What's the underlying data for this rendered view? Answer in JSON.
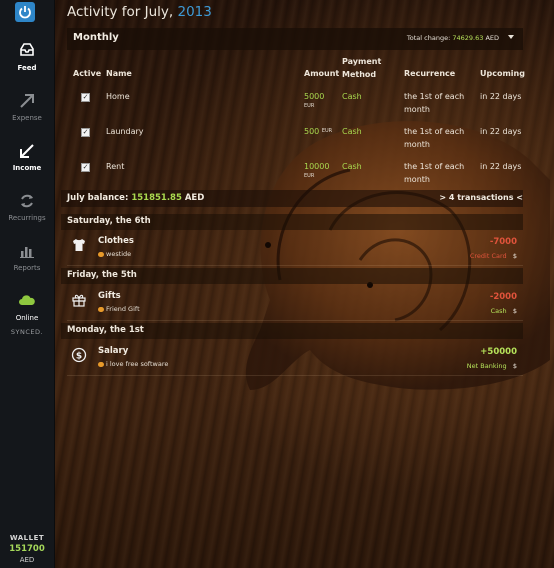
{
  "sidebar": {
    "app_icon": "power-icon",
    "items": [
      {
        "label": "Feed",
        "icon": "inbox-icon",
        "active": true
      },
      {
        "label": "Expense",
        "icon": "arrow-up-right-icon",
        "active": false
      },
      {
        "label": "Income",
        "icon": "arrow-down-left-icon",
        "active": true
      },
      {
        "label": "Recurrings",
        "icon": "refresh-icon",
        "active": false
      },
      {
        "label": "Reports",
        "icon": "bar-chart-icon",
        "active": false
      },
      {
        "label": "Online",
        "icon": "cloud-icon",
        "active": true
      }
    ],
    "synced": "SYNCED.",
    "wallet": {
      "label": "WALLET",
      "amount": "151700",
      "currency": "AED"
    }
  },
  "header": {
    "title": "Activity for July,",
    "year": "2013"
  },
  "monthly": {
    "title": "Monthly",
    "total_label": "Total change:",
    "total_amount": "74629.63",
    "total_currency": "AED",
    "columns": {
      "active": "Active",
      "name": "Name",
      "amount": "Amount",
      "payment_method_line1": "Payment",
      "payment_method_line2": "Method",
      "recurrence": "Recurrence",
      "upcoming": "Upcoming"
    },
    "rows": [
      {
        "name": "Home",
        "amount": "5000",
        "currency": "EUR",
        "method": "Cash",
        "recurrence_line1": "the 1st of each",
        "recurrence_line2": "month",
        "upcoming": "in 22 days"
      },
      {
        "name": "Laundary",
        "amount": "500",
        "currency": "EUR",
        "method": "Cash",
        "recurrence_line1": "the 1st of each",
        "recurrence_line2": "month",
        "upcoming": "in 22 days"
      },
      {
        "name": "Rent",
        "amount": "10000",
        "currency": "EUR",
        "method": "Cash",
        "recurrence_line1": "the 1st of each",
        "recurrence_line2": "month",
        "upcoming": "in 22 days"
      }
    ]
  },
  "balance": {
    "label": "July balance:",
    "amount": "151851.85",
    "currency": "AED",
    "toggle": "> 4 transactions <"
  },
  "days": [
    {
      "header": "Saturday, the 6th",
      "transaction": {
        "name": "Clothes",
        "note": "westide",
        "amount": "-7000",
        "method": "Credit Card",
        "currency": "$",
        "icon": "tshirt-icon"
      }
    },
    {
      "header": "Friday, the 5th",
      "transaction": {
        "name": "Gifts",
        "note": "Friend Gift",
        "amount": "-2000",
        "method": "Cash",
        "currency": "$",
        "icon": "gift-icon"
      }
    },
    {
      "header": "Monday, the 1st",
      "transaction": {
        "name": "Salary",
        "note": "i love free software",
        "amount": "+50000",
        "method": "Net Banking",
        "currency": "$",
        "icon": "dollar-coin-icon"
      }
    }
  ],
  "colors": {
    "accent_blue": "#3e9ad6",
    "positive": "#b5e25a",
    "negative": "#e0533b",
    "sidebar_bg": "#14171b"
  }
}
